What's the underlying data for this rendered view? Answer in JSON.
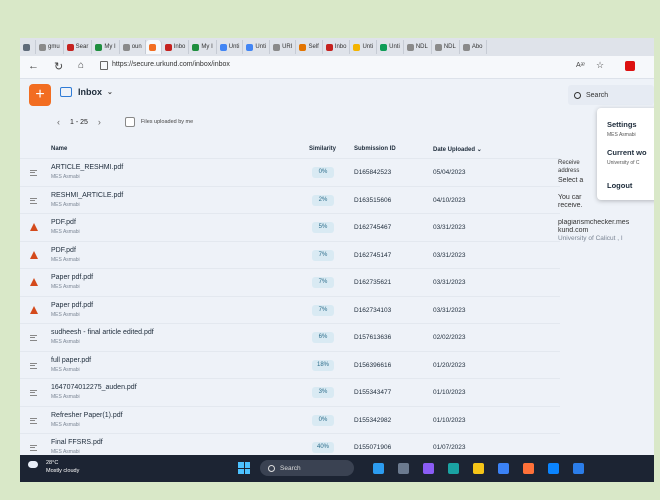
{
  "browser": {
    "tabs": [
      {
        "label": "",
        "color": "#5f6b7a"
      },
      {
        "label": "gmu",
        "color": "#8a8a8a"
      },
      {
        "label": "Sear",
        "color": "#c5221f"
      },
      {
        "label": "My I",
        "color": "#1e8e3e"
      },
      {
        "label": "oun",
        "color": "#8a8a8a"
      },
      {
        "label": "",
        "color": "#f26d21",
        "active": true
      },
      {
        "label": "Inbo",
        "color": "#c5221f"
      },
      {
        "label": "My I",
        "color": "#1e8e3e"
      },
      {
        "label": "Unti",
        "color": "#4285f4"
      },
      {
        "label": "Unti",
        "color": "#4285f4"
      },
      {
        "label": "URI",
        "color": "#8a8a8a"
      },
      {
        "label": "Self",
        "color": "#e37400"
      },
      {
        "label": "Inbo",
        "color": "#c5221f"
      },
      {
        "label": "Unti",
        "color": "#f4b400"
      },
      {
        "label": "Unti",
        "color": "#0f9d58"
      },
      {
        "label": "NDL",
        "color": "#8a8a8a"
      },
      {
        "label": "NDL",
        "color": "#8a8a8a"
      },
      {
        "label": "Abo",
        "color": "#8a8a8a"
      }
    ],
    "url": "https://secure.urkund.com/inbox/inbox"
  },
  "app": {
    "add_label": "+",
    "inbox_label": "Inbox",
    "search_placeholder": "Search",
    "pager_range": "1 - 25",
    "filter_label": "Files uploaded by me"
  },
  "table": {
    "columns": {
      "name": "Name",
      "similarity": "Similarity",
      "submission_id": "Submission ID",
      "date_uploaded": "Date Uploaded"
    },
    "rows": [
      {
        "name": "ARTICLE_RESHMI.pdf",
        "owner": "MES Asmabi",
        "similarity": "0%",
        "id": "D165842523",
        "date": "05/04/2023",
        "icon": "doc"
      },
      {
        "name": "RESHMI_ARTICLE.pdf",
        "owner": "MES Asmabi",
        "similarity": "2%",
        "id": "D163515606",
        "date": "04/10/2023",
        "icon": "doc"
      },
      {
        "name": "PDF.pdf",
        "owner": "MES Asmabi",
        "similarity": "5%",
        "id": "D162745467",
        "date": "03/31/2023",
        "icon": "pdf"
      },
      {
        "name": "PDF.pdf",
        "owner": "MES Asmabi",
        "similarity": "7%",
        "id": "D162745147",
        "date": "03/31/2023",
        "icon": "pdf"
      },
      {
        "name": "Paper pdf.pdf",
        "owner": "MES Asmabi",
        "similarity": "7%",
        "id": "D162735621",
        "date": "03/31/2023",
        "icon": "pdf"
      },
      {
        "name": "Paper pdf.pdf",
        "owner": "MES Asmabi",
        "similarity": "7%",
        "id": "D162734103",
        "date": "03/31/2023",
        "icon": "pdf"
      },
      {
        "name": "sudheesh - final article edited.pdf",
        "owner": "MES Asmabi",
        "similarity": "6%",
        "id": "D157613636",
        "date": "02/02/2023",
        "icon": "doc"
      },
      {
        "name": "full paper.pdf",
        "owner": "MES Asmabi",
        "similarity": "18%",
        "id": "D156396616",
        "date": "01/20/2023",
        "icon": "doc"
      },
      {
        "name": "1647074012275_auden.pdf",
        "owner": "MES Asmabi",
        "similarity": "3%",
        "id": "D155343477",
        "date": "01/10/2023",
        "icon": "doc"
      },
      {
        "name": "Refresher Paper(1).pdf",
        "owner": "MES Asmabi",
        "similarity": "0%",
        "id": "D155342982",
        "date": "01/10/2023",
        "icon": "doc"
      },
      {
        "name": "Final FFSRS.pdf",
        "owner": "MES Asmabi",
        "similarity": "40%",
        "id": "D155071906",
        "date": "01/07/2023",
        "icon": "doc"
      }
    ]
  },
  "side_panel": {
    "line1": "Receive",
    "line2": "address",
    "line3": "Select a",
    "line4": "You car",
    "line5": "receive.",
    "email1": "plagiarismchecker.mes",
    "email2": "kund.com",
    "org": "University of Calicut , I"
  },
  "menu": {
    "settings": "Settings",
    "settings_sub": "MES Asmabi",
    "current": "Current wo",
    "current_sub": "University of C",
    "logout": "Logout"
  },
  "taskbar": {
    "temp": "28°C",
    "weather": "Mostly cloudy",
    "search": "Search",
    "icons": [
      "#2c9cf0",
      "#6b7a8f",
      "#8a5cf5",
      "#1aa3a3",
      "#f5c518",
      "#3b82f6",
      "#ff7139",
      "#0a84ff",
      "#2b7de9"
    ]
  }
}
